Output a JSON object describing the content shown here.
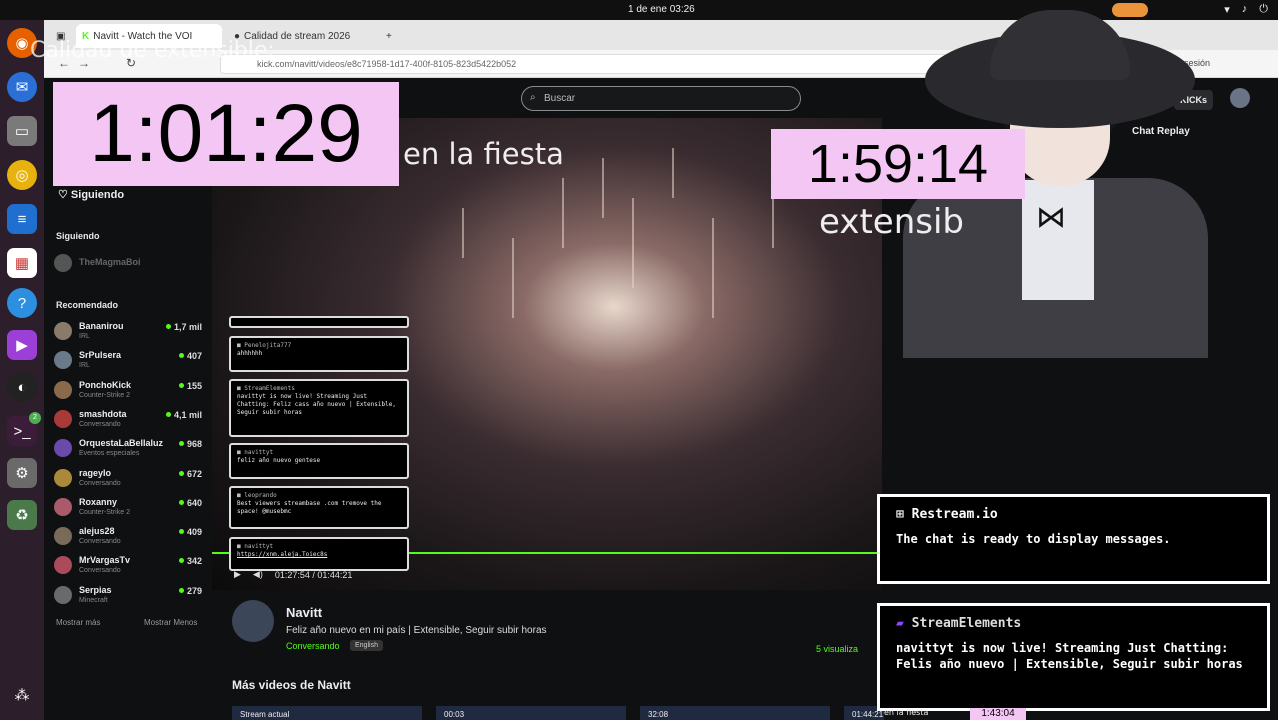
{
  "system": {
    "clock": "1 de ene  03:26"
  },
  "browser": {
    "tabs": [
      {
        "label": "Navitt - Watch the VOI"
      },
      {
        "label": "Calidad de stream 2026"
      }
    ],
    "url": "kick.com/navitt/videos/e8c71958-1d17-400f-8105-823d5422b052",
    "signin": "sesión"
  },
  "dock": {
    "items": [
      "firefox-icon",
      "thunderbird-icon",
      "files-icon",
      "rhythmbox-icon",
      "writer-icon",
      "software-icon",
      "help-icon",
      "video-icon",
      "obs-icon",
      "terminal-icon",
      "settings-icon",
      "trash-icon",
      "apps-icon"
    ],
    "terminal_badge": "2"
  },
  "kick": {
    "search_placeholder": "Buscar",
    "kicks_label": "KICKs",
    "chat_replay": "Chat Replay",
    "sidebar": {
      "following_button": "Siguiendo",
      "following_heading": "Siguiendo",
      "following_user": "TheMagmaBoi",
      "recommended_heading": "Recomendado",
      "channels": [
        {
          "name": "Bananirou",
          "category": "IRL",
          "viewers": "1,7 mil"
        },
        {
          "name": "SrPulsera",
          "category": "IRL",
          "viewers": "407"
        },
        {
          "name": "PonchoKick",
          "category": "Counter-Strike 2",
          "viewers": "155"
        },
        {
          "name": "smashdota",
          "category": "Conversando",
          "viewers": "4,1 mil"
        },
        {
          "name": "OrquestaLaBellaluz",
          "category": "Eventos especiales",
          "viewers": "968"
        },
        {
          "name": "rageylo",
          "category": "Conversando",
          "viewers": "672"
        },
        {
          "name": "Roxanny",
          "category": "Counter-Strike 2",
          "viewers": "640"
        },
        {
          "name": "alejus28",
          "category": "Conversando",
          "viewers": "409"
        },
        {
          "name": "MrVargasTv",
          "category": "Conversando",
          "viewers": "342"
        },
        {
          "name": "Serpias",
          "category": "Minecraft",
          "viewers": "279"
        }
      ],
      "show_more": "Mostrar más",
      "show_less": "Mostrar Menos"
    },
    "player": {
      "time": "01:27:54 / 01:44:21"
    },
    "channel": {
      "name": "Navitt",
      "title": "Feliz año nuevo en mi país | Extensible, Seguir subir horas",
      "category": "Conversando",
      "language": "English",
      "views": "5 visualiza"
    },
    "more_videos_heading": "Más videos de Navitt",
    "thumbnails": [
      "Stream actual",
      "00:03",
      "32:08",
      "01:44:21"
    ]
  },
  "video_chat": [
    {
      "user": "",
      "text": ""
    },
    {
      "user": "Penelojita777",
      "text": "ahhhhhh"
    },
    {
      "user": "StreamElements",
      "text": "navittyt is now live! Streaming Just Chatting: Feliz cass año nuevo | Extensible, Seguir subir horas"
    },
    {
      "user": "navittyt",
      "text": "feliz año nuevo gentese"
    },
    {
      "user": "leoprando",
      "text": "Best viewers streambase .com tremove the space! @musebmc"
    },
    {
      "user": "navittyt",
      "text": "https://xnm.aleja.Toiec8s"
    }
  ],
  "overlay": {
    "timer_main": "1:01:29",
    "timer_secondary": "1:59:14",
    "timer_bottom": "1:43:04",
    "caption_main": "en la fiesta",
    "caption_secondary": "extensib",
    "caption_ghost": "Calidad de extensible:",
    "caption_bottom": "en la fiesta"
  },
  "restream": {
    "title": "Restream.io",
    "message": "The chat is ready to display messages."
  },
  "streamelements": {
    "title": "StreamElements",
    "message": "navittyt is now live! Streaming Just Chatting: Felis año nuevo | Extensible, Seguir subir horas"
  },
  "colors": {
    "accent": "#53fc18",
    "timer_bg": "#f4c6f4",
    "dock": "#2c1e2b"
  }
}
